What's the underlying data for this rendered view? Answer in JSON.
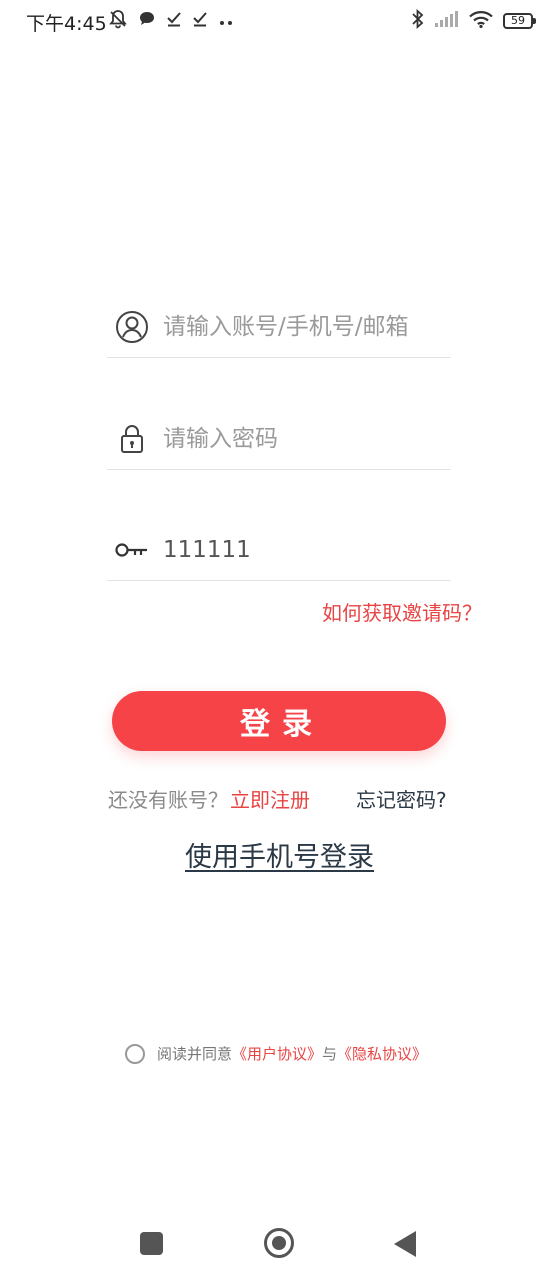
{
  "status_bar": {
    "time": "下午4:45",
    "battery": "59",
    "icons": [
      "muted-bell-icon",
      "chat-bubble-icon",
      "check-icon",
      "check-icon",
      "more-dots-icon",
      "bluetooth-icon",
      "signal-icon",
      "wifi-icon",
      "battery-icon"
    ]
  },
  "form": {
    "account_placeholder": "请输入账号/手机号/邮箱",
    "password_placeholder": "请输入密码",
    "invite_code_value": "111111",
    "invite_help": "如何获取邀请码？"
  },
  "login_button": "登录",
  "register": {
    "prompt": "还没有账号？",
    "link": "立即注册"
  },
  "forgot_password": "忘记密码?",
  "phone_login": "使用手机号登录",
  "agreement": {
    "prefix": "阅读并同意",
    "user_agreement": "《用户协议》",
    "conjunction": "与",
    "privacy_policy": "《隐私协议》"
  },
  "colors": {
    "accent": "#f64348",
    "link_red": "#e84444",
    "dark_link": "#2b3845"
  }
}
